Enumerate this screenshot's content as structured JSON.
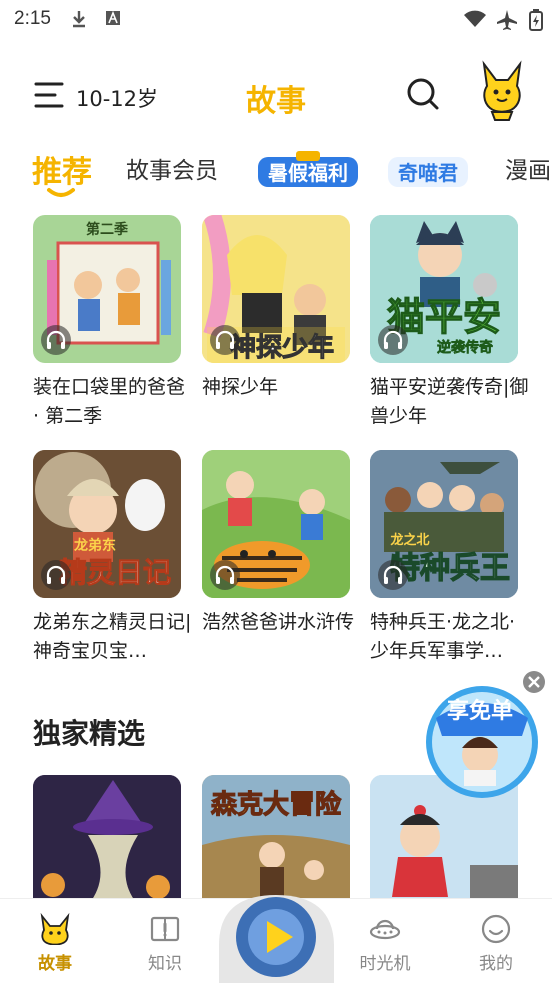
{
  "status_bar": {
    "time": "2:15"
  },
  "header": {
    "age": "10-12岁",
    "title": "故事"
  },
  "tabs": [
    "推荐",
    "故事会员",
    "暑假福利",
    "奇喵君",
    "漫画"
  ],
  "cards": [
    {
      "title": "装在口袋里的爸爸 · 第二季",
      "cover_text": "第二季",
      "cover_color": "#a8d596"
    },
    {
      "title": "神探少年",
      "cover_text": "神探少年",
      "cover_color": "#f5e38a"
    },
    {
      "title": "猫平安逆袭传奇|御兽少年",
      "cover_text": "猫平安",
      "cover_sub": "逆袭传奇",
      "cover_color": "#7fc7c6"
    },
    {
      "title": "龙弟东之精灵日记|神奇宝贝宝…",
      "cover_text": "精灵日记",
      "cover_sub": "龙弟东",
      "cover_color": "#8a6a4a"
    },
    {
      "title": "浩然爸爸讲水浒传",
      "cover_text": "",
      "cover_color": "#8ec36a"
    },
    {
      "title": "特种兵王·龙之北·少年兵军事学…",
      "cover_text": "特种兵王",
      "cover_sub": "龙之北",
      "cover_color": "#4f6f8a"
    }
  ],
  "section": {
    "title": "独家精选"
  },
  "featured": [
    {
      "cover_color": "#3d2b5a"
    },
    {
      "cover_text": "森克大冒险",
      "cover_color": "#c9a46a"
    },
    {
      "cover_color": "#b5d3e9"
    }
  ],
  "promo": {
    "label": "享免单"
  },
  "bottom_nav": [
    {
      "label": "故事"
    },
    {
      "label": "知识"
    },
    {
      "label": "时光机"
    },
    {
      "label": "我的"
    }
  ]
}
